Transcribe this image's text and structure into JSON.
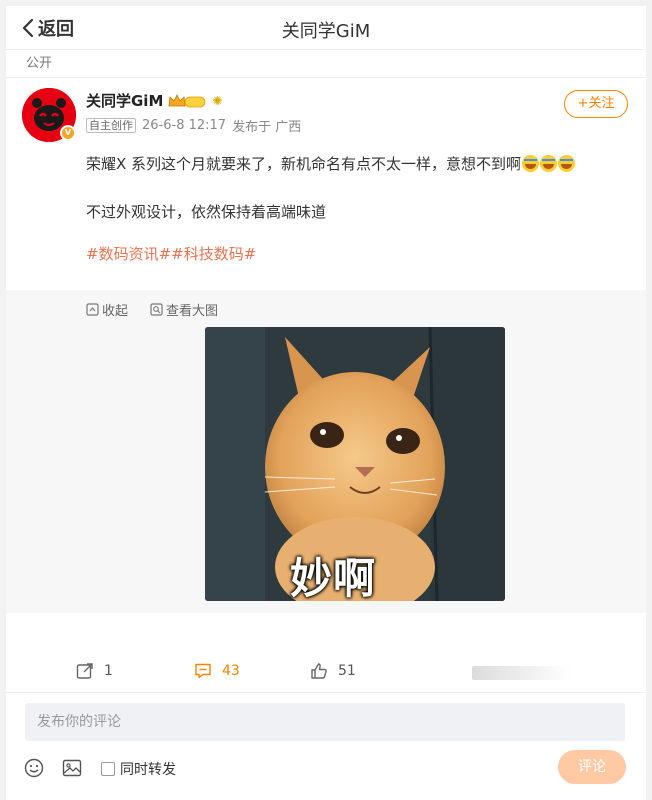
{
  "header": {
    "back_label": "返回",
    "title": "关同学GiM"
  },
  "visibility": "公开",
  "post": {
    "author_name": "关同学GiM",
    "vip_level": "II",
    "source_tag": "自主创作",
    "date": "26-6-8 12:17",
    "location": "发布于 广西",
    "follow_label": "+关注",
    "paragraph_1": "荣耀X 系列这个月就要来了，新机命名有点不太一样，意想不到啊",
    "paragraph_2": "不过外观设计，依然保持着高端味道",
    "topics": "#数码资讯##科技数码#",
    "emoji_name": "crying-laughing-emoji"
  },
  "media": {
    "collapse_label": "收起",
    "view_large_label": "查看大图",
    "image_caption": "妙啊"
  },
  "toolbar": {
    "repost_count": "1",
    "comment_count": "43",
    "like_count": "51"
  },
  "comment": {
    "placeholder": "发布你的评论",
    "repost_label": "同时转发",
    "submit_label": "评论"
  },
  "colors": {
    "accent": "#ff8200",
    "topic": "#eb7350",
    "avatar_bg": "#e60012",
    "submit_disabled": "#ffc9a3"
  }
}
